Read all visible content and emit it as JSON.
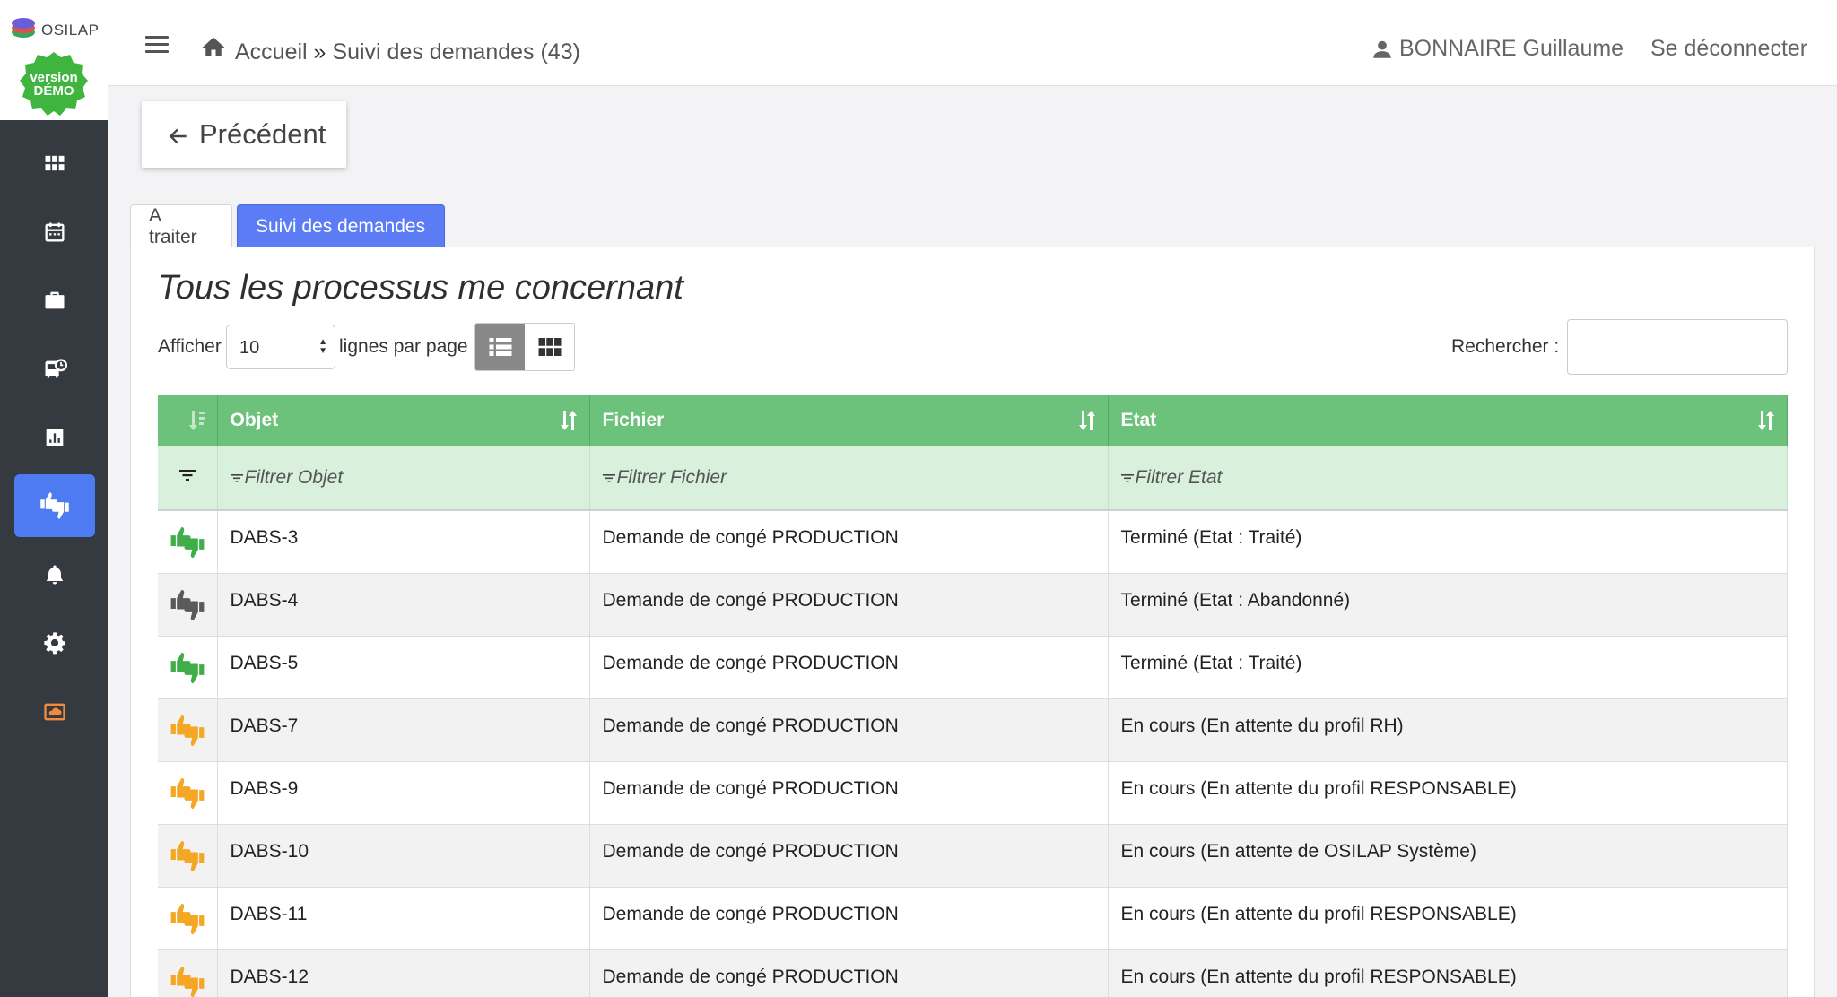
{
  "app": {
    "logo_text": "OSILAP",
    "badge_line1": "version",
    "badge_line2": "DÉMO"
  },
  "sidebar": {
    "items": [
      {
        "icon": "grid-icon",
        "active": false,
        "color": "#ffffff"
      },
      {
        "icon": "calendar-icon",
        "active": false,
        "color": "#ffffff"
      },
      {
        "icon": "briefcase-icon",
        "active": false,
        "color": "#ffffff"
      },
      {
        "icon": "bus-clock-icon",
        "active": false,
        "color": "#ffffff"
      },
      {
        "icon": "bar-chart-icon",
        "active": false,
        "color": "#ffffff"
      },
      {
        "icon": "thumbs-icon",
        "active": true,
        "color": "#ffffff"
      },
      {
        "icon": "bell-icon",
        "active": false,
        "color": "#ffffff"
      },
      {
        "icon": "gear-icon",
        "active": false,
        "color": "#ffffff"
      },
      {
        "icon": "cloud-screen-icon",
        "active": false,
        "color": "#f08a3c"
      }
    ]
  },
  "header": {
    "crumb_home": "Accueil",
    "crumb_sep": "»",
    "crumb_current": "Suivi des demandes (43)",
    "user_name": "BONNAIRE Guillaume",
    "logout": "Se déconnecter"
  },
  "back_label": "Précédent",
  "tabs": [
    {
      "label": "A traiter",
      "active": false
    },
    {
      "label": "Suivi des demandes",
      "active": true
    }
  ],
  "panel": {
    "title": "Tous les processus me concernant",
    "show_label": "Afficher",
    "page_length": "10",
    "per_page_label": "lignes par page",
    "search_label": "Rechercher :",
    "search_value": ""
  },
  "table": {
    "columns": [
      "Objet",
      "Fichier",
      "Etat"
    ],
    "filters": [
      "Filtrer Objet",
      "Filtrer Fichier",
      "Filtrer Etat"
    ],
    "rows": [
      {
        "status_color": "#3fae49",
        "objet": "DABS-3",
        "fichier": "Demande de congé PRODUCTION",
        "etat": "Terminé (Etat : Traité)"
      },
      {
        "status_color": "#5a5a5a",
        "objet": "DABS-4",
        "fichier": "Demande de congé PRODUCTION",
        "etat": "Terminé (Etat : Abandonné)"
      },
      {
        "status_color": "#3fae49",
        "objet": "DABS-5",
        "fichier": "Demande de congé PRODUCTION",
        "etat": "Terminé (Etat : Traité)"
      },
      {
        "status_color": "#f5a623",
        "objet": "DABS-7",
        "fichier": "Demande de congé PRODUCTION",
        "etat": "En cours (En attente du profil RH)"
      },
      {
        "status_color": "#f5a623",
        "objet": "DABS-9",
        "fichier": "Demande de congé PRODUCTION",
        "etat": "En cours (En attente du profil RESPONSABLE)"
      },
      {
        "status_color": "#f5a623",
        "objet": "DABS-10",
        "fichier": "Demande de congé PRODUCTION",
        "etat": "En cours (En attente de OSILAP Système)"
      },
      {
        "status_color": "#f5a623",
        "objet": "DABS-11",
        "fichier": "Demande de congé PRODUCTION",
        "etat": "En cours (En attente du profil RESPONSABLE)"
      },
      {
        "status_color": "#f5a623",
        "objet": "DABS-12",
        "fichier": "Demande de congé PRODUCTION",
        "etat": "En cours (En attente du profil RESPONSABLE)"
      }
    ]
  }
}
